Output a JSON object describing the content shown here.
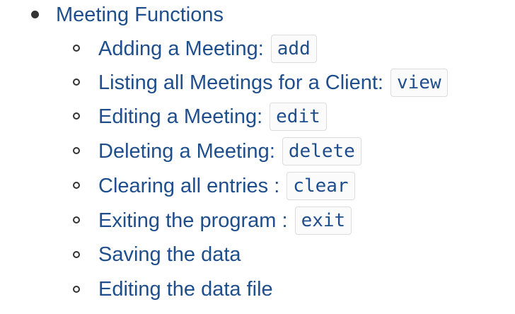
{
  "section": {
    "title": "Meeting Functions",
    "items": [
      {
        "label": "Adding a Meeting:",
        "code": "add"
      },
      {
        "label": "Listing all Meetings for a Client:",
        "code": "view"
      },
      {
        "label": "Editing a Meeting:",
        "code": "edit"
      },
      {
        "label": "Deleting a Meeting:",
        "code": "delete"
      },
      {
        "label": "Clearing all entries :",
        "code": "clear"
      },
      {
        "label": "Exiting the program :",
        "code": "exit"
      },
      {
        "label": "Saving the data",
        "code": ""
      },
      {
        "label": "Editing the data file",
        "code": ""
      }
    ]
  }
}
